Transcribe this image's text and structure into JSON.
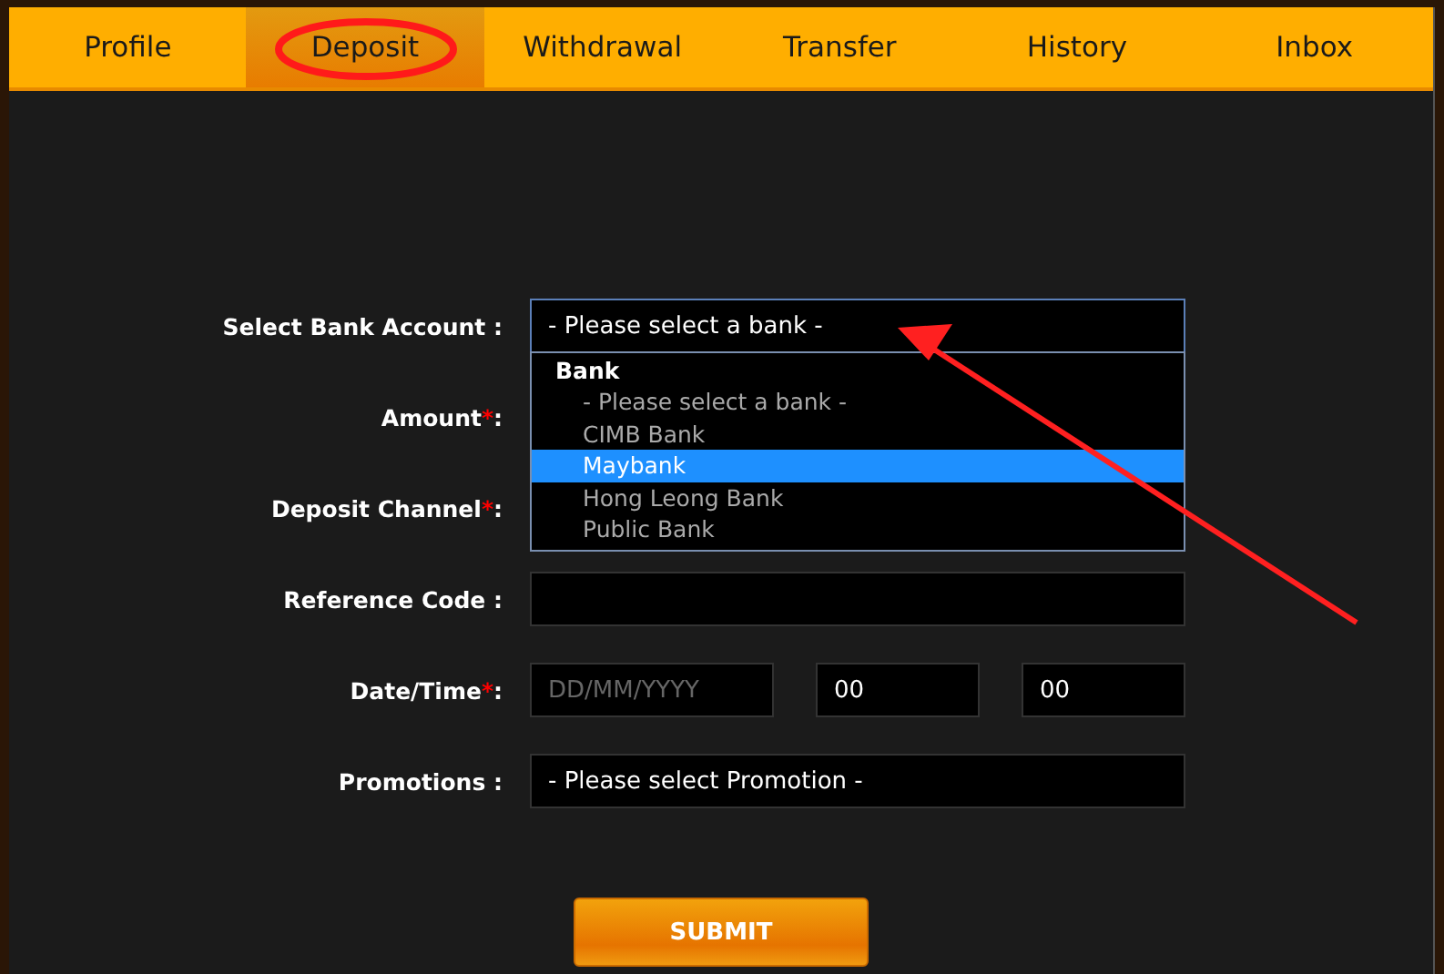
{
  "tabs": [
    {
      "label": "Profile",
      "selected": false
    },
    {
      "label": "Deposit",
      "selected": true
    },
    {
      "label": "Withdrawal",
      "selected": false
    },
    {
      "label": "Transfer",
      "selected": false
    },
    {
      "label": "History",
      "selected": false
    },
    {
      "label": "Inbox",
      "selected": false
    }
  ],
  "form": {
    "fields": [
      {
        "kind": "select",
        "label": "Select Bank Account :",
        "value": "- Please select a bank -"
      },
      {
        "kind": "covered",
        "label": "Amount",
        "required_mark": "*",
        "colon": ":"
      },
      {
        "kind": "covered",
        "label": "Deposit Channel",
        "required_mark": "*",
        "colon": ":"
      },
      {
        "kind": "text",
        "label": "Reference Code :"
      },
      {
        "kind": "datetime",
        "label": "Date/Time",
        "required_mark": "*",
        "colon": ":",
        "placeholder": "DD/MM/YYYY",
        "hour": "00",
        "minute": "00"
      },
      {
        "kind": "select",
        "label": "Promotions :",
        "value": "- Please select Promotion -"
      }
    ],
    "dropdown": {
      "group": "Bank",
      "options": [
        {
          "label": "- Please select a bank -",
          "selected": false
        },
        {
          "label": "CIMB Bank",
          "selected": false
        },
        {
          "label": "Maybank",
          "selected": true
        },
        {
          "label": "Hong Leong Bank",
          "selected": false
        },
        {
          "label": "Public Bank",
          "selected": false
        }
      ]
    },
    "submit": "SUBMIT"
  }
}
